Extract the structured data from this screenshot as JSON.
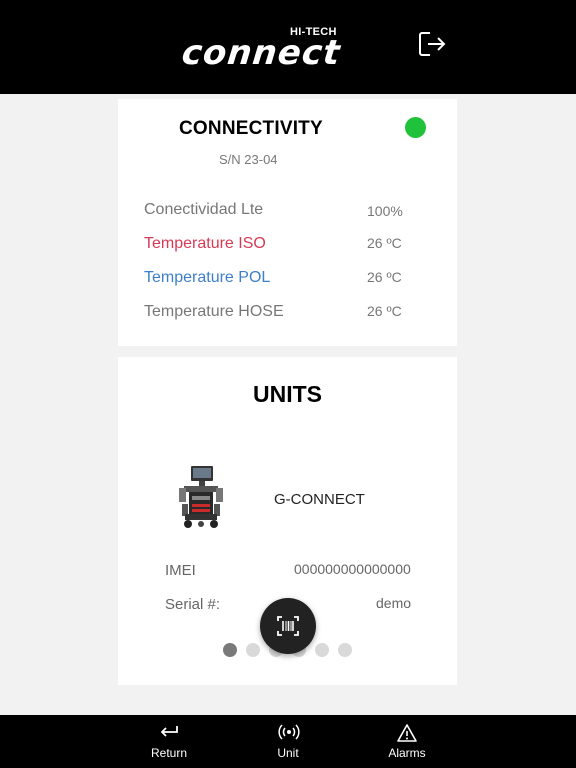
{
  "header": {
    "brand": "HI-TECH",
    "wordmark": "connect",
    "logout_icon": "logout-icon"
  },
  "connectivity": {
    "title": "CONNECTIVITY",
    "status_color": "#1fc23a",
    "serial": "S/N 23-04",
    "rows": [
      {
        "label": "Conectividad Lte",
        "value": "100%",
        "color": "#777777"
      },
      {
        "label": "Temperature ISO",
        "value": "26 ºC",
        "color": "#d83a55"
      },
      {
        "label": "Temperature POL",
        "value": "26 ºC",
        "color": "#3d7fcc"
      },
      {
        "label": "Temperature HOSE",
        "value": "26 ºC",
        "color": "#777777"
      }
    ]
  },
  "units": {
    "title": "UNITS",
    "unit_name": "G-CONNECT",
    "imei_label": "IMEI",
    "imei_value": "000000000000000",
    "serial_label": "Serial #:",
    "serial_value": "demo",
    "pagination": {
      "count": 6,
      "active_index": 0
    }
  },
  "scan_button_icon": "barcode-scan-icon",
  "bottom_nav": [
    {
      "label": "Return",
      "icon": "return-arrow-icon"
    },
    {
      "label": "Unit",
      "icon": "signal-icon"
    },
    {
      "label": "Alarms",
      "icon": "warning-icon"
    }
  ]
}
